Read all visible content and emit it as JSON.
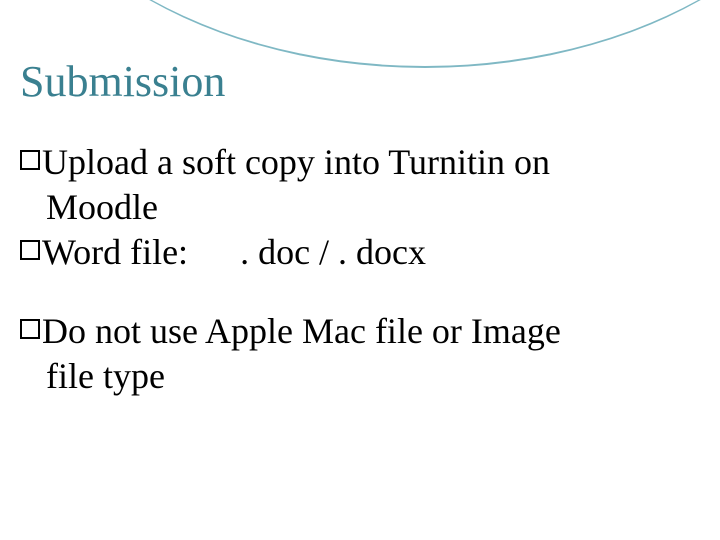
{
  "slide": {
    "title": "Submission",
    "bullets": {
      "b1_line1": "Upload a soft copy into Turnitin on",
      "b1_line2": "Moodle",
      "b2_label": "Word file:",
      "b2_value": ". doc / . docx",
      "b3_line1": "Do not use Apple Mac file or Image",
      "b3_line2": "file type"
    }
  }
}
